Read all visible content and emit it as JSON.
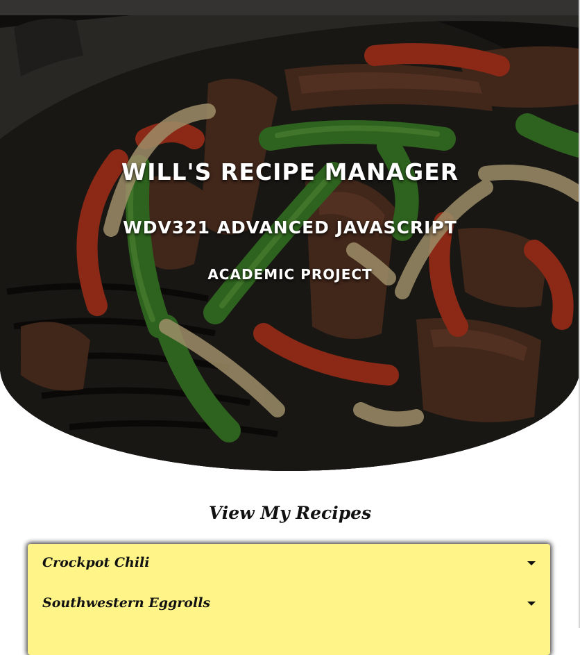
{
  "hero": {
    "title": "Will's Recipe Manager",
    "subtitle": "WDV321 Advanced JavaScript",
    "tagline": "Academic Project"
  },
  "recipes_section": {
    "heading": "View My Recipes",
    "items": [
      {
        "label": "Crockpot Chili",
        "icon": "chevron-down-icon"
      },
      {
        "label": "Southwestern Eggrolls",
        "icon": "chevron-down-icon"
      }
    ]
  },
  "colors": {
    "accordion_bg": "#fef488",
    "hero_text": "#ffffff",
    "heading_text": "#111111"
  }
}
